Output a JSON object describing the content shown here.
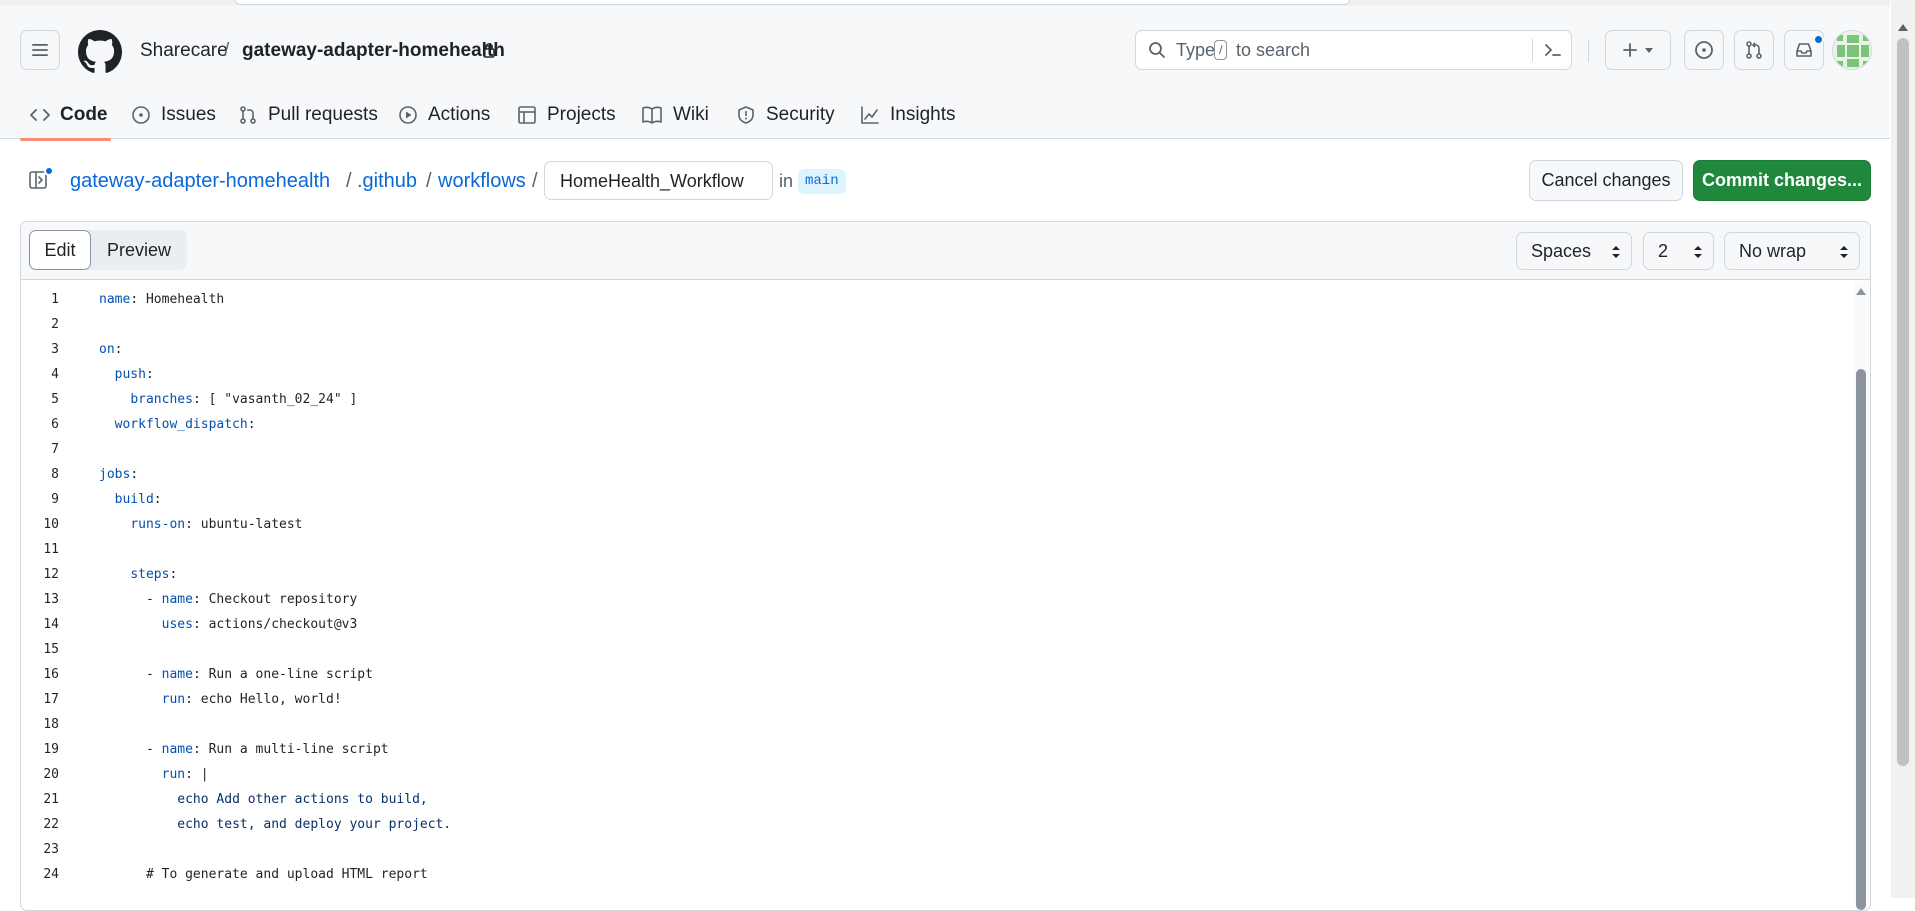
{
  "header": {
    "owner": "Sharecare",
    "separator": "/",
    "repo": "gateway-adapter-homehealth",
    "search": {
      "placeholder_prefix": "Type",
      "key": "/",
      "placeholder_suffix": "to search"
    }
  },
  "tabs": [
    {
      "label": "Code",
      "icon": "code-icon",
      "selected": true
    },
    {
      "label": "Issues",
      "icon": "issue-icon"
    },
    {
      "label": "Pull requests",
      "icon": "pull-request-icon"
    },
    {
      "label": "Actions",
      "icon": "play-icon"
    },
    {
      "label": "Projects",
      "icon": "table-icon"
    },
    {
      "label": "Wiki",
      "icon": "book-icon"
    },
    {
      "label": "Security",
      "icon": "shield-icon"
    },
    {
      "label": "Insights",
      "icon": "graph-icon"
    }
  ],
  "editor_header": {
    "path": [
      "gateway-adapter-homehealth",
      ".github",
      "workflows"
    ],
    "separator": "/",
    "filename": "HomeHealth_Workflow",
    "in_label": "in",
    "branch": "main",
    "cancel_label": "Cancel changes",
    "commit_label": "Commit changes..."
  },
  "toolbar": {
    "edit_label": "Edit",
    "preview_label": "Preview",
    "indent_mode": "Spaces",
    "indent_size": "2",
    "wrap_mode": "No wrap"
  },
  "code_lines": [
    {
      "n": "1",
      "indent": "",
      "key": "name",
      "rest": ": Homehealth"
    },
    {
      "n": "2",
      "indent": "",
      "key": "",
      "rest": ""
    },
    {
      "n": "3",
      "indent": "",
      "key": "on",
      "rest": ":"
    },
    {
      "n": "4",
      "indent": "  ",
      "key": "push",
      "rest": ":"
    },
    {
      "n": "5",
      "indent": "    ",
      "key": "branches",
      "rest": ": [ \"vasanth_02_24\" ]"
    },
    {
      "n": "6",
      "indent": "  ",
      "key": "workflow_dispatch",
      "rest": ":"
    },
    {
      "n": "7",
      "indent": "",
      "key": "",
      "rest": ""
    },
    {
      "n": "8",
      "indent": "",
      "key": "jobs",
      "rest": ":"
    },
    {
      "n": "9",
      "indent": "  ",
      "key": "build",
      "rest": ":"
    },
    {
      "n": "10",
      "indent": "    ",
      "key": "runs-on",
      "rest": ": ubuntu-latest"
    },
    {
      "n": "11",
      "indent": "",
      "key": "",
      "rest": ""
    },
    {
      "n": "12",
      "indent": "    ",
      "key": "steps",
      "rest": ":"
    },
    {
      "n": "13",
      "indent": "      - ",
      "key": "name",
      "rest": ": Checkout repository"
    },
    {
      "n": "14",
      "indent": "        ",
      "key": "uses",
      "rest": ": actions/checkout@v3"
    },
    {
      "n": "15",
      "indent": "",
      "key": "",
      "rest": ""
    },
    {
      "n": "16",
      "indent": "      - ",
      "key": "name",
      "rest": ": Run a one-line script"
    },
    {
      "n": "17",
      "indent": "        ",
      "key": "run",
      "rest": ": echo Hello, world!"
    },
    {
      "n": "18",
      "indent": "",
      "key": "",
      "rest": ""
    },
    {
      "n": "19",
      "indent": "      - ",
      "key": "name",
      "rest": ": Run a multi-line script"
    },
    {
      "n": "20",
      "indent": "        ",
      "key": "run",
      "rest": ": |"
    },
    {
      "n": "21",
      "indent": "          ",
      "key": "",
      "rest": "echo Add other actions to build,"
    },
    {
      "n": "22",
      "indent": "          ",
      "key": "",
      "rest": "echo test, and deploy your project."
    },
    {
      "n": "23",
      "indent": "",
      "key": "",
      "rest": ""
    },
    {
      "n": "24",
      "indent": "      ",
      "key": "",
      "rest": "# To generate and upload HTML report"
    }
  ],
  "colors": {
    "accent": "#0969da",
    "commit_green": "#1f883d",
    "tab_underline": "#fd8c73",
    "yaml_key": "#0550ae"
  }
}
